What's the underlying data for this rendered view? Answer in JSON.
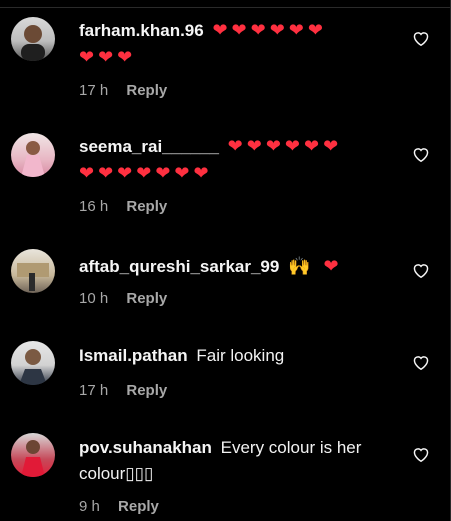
{
  "comments": [
    {
      "username": "farham.khan.96",
      "text_line1": "❤❤❤❤❤❤",
      "text_line2": "❤❤❤",
      "time": "17 h",
      "reply": "Reply"
    },
    {
      "username": "seema_rai______",
      "text_line1": "❤❤❤❤❤❤",
      "text_line2": "❤❤❤❤❤❤❤",
      "time": "16 h",
      "reply": "Reply"
    },
    {
      "username": "aftab_qureshi_sarkar_99",
      "text_line1": "🙌 ❤",
      "time": "10 h",
      "reply": "Reply"
    },
    {
      "username": "Ismail.pathan",
      "text_line1": "Fair looking",
      "time": "17 h",
      "reply": "Reply"
    },
    {
      "username": "pov.suhanakhan",
      "text_line1": "Every colour is her",
      "text_line2": "colour▯▯▯",
      "time": "9 h",
      "reply": "Reply"
    }
  ],
  "icons": {
    "like": "heart-outline-icon"
  },
  "colors": {
    "background": "#000000",
    "heart": "#ff3040",
    "meta": "#a8a8a8"
  }
}
